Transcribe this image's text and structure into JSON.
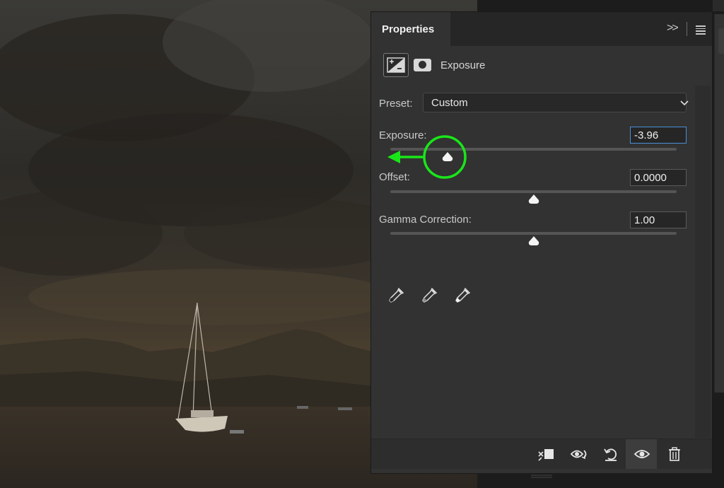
{
  "panel": {
    "tab_label": "Properties",
    "collapse_label": ">>",
    "adjustment_title": "Exposure"
  },
  "preset": {
    "label": "Preset:",
    "selected": "Custom"
  },
  "controls": {
    "exposure": {
      "label": "Exposure:",
      "value": "-3.96",
      "slider_fraction": 0.2
    },
    "offset": {
      "label": "Offset:",
      "value": "0.0000",
      "slider_fraction": 0.5
    },
    "gamma": {
      "label": "Gamma Correction:",
      "value": "1.00",
      "slider_fraction": 0.5
    }
  },
  "icons": {
    "adjustment": "exposure-adjustment-icon",
    "mask": "layer-mask-icon",
    "eyedroppers": [
      "black-point-eyedropper-icon",
      "gray-point-eyedropper-icon",
      "white-point-eyedropper-icon"
    ],
    "toolbar": [
      "clip-to-layer-icon",
      "view-previous-state-icon",
      "reset-adjustment-icon",
      "toggle-visibility-icon",
      "delete-adjustment-icon"
    ]
  },
  "colors": {
    "annotation_green": "#19e619",
    "field_focus": "#4a8fd6",
    "panel_bg": "#323232"
  }
}
